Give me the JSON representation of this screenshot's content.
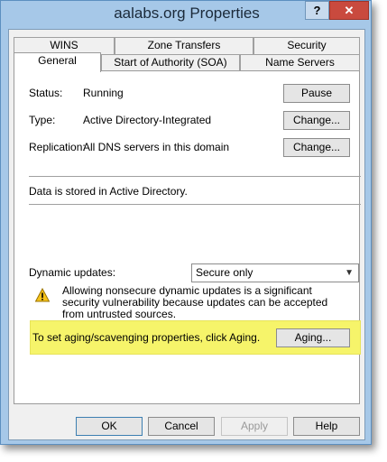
{
  "window": {
    "title": "aalabs.org Properties",
    "help_glyph": "?",
    "close_glyph": "✕"
  },
  "tabs": {
    "row1": [
      "WINS",
      "Zone Transfers",
      "Security"
    ],
    "row2": [
      "General",
      "Start of Authority (SOA)",
      "Name Servers"
    ],
    "active": "General"
  },
  "general": {
    "status_label": "Status:",
    "status_value": "Running",
    "pause_button": "Pause",
    "type_label": "Type:",
    "type_value": "Active Directory-Integrated",
    "type_change_button": "Change...",
    "replication_label": "Replication:",
    "replication_value": "All DNS servers in this domain",
    "replication_change_button": "Change...",
    "storage_text": "Data is stored in Active Directory.",
    "dynamic_updates_label": "Dynamic updates:",
    "dynamic_updates_value": "Secure only",
    "warning_text": "Allowing nonsecure dynamic updates is a significant security vulnerability because updates can be accepted from untrusted sources.",
    "aging_text": "To set aging/scavenging properties, click Aging.",
    "aging_button": "Aging..."
  },
  "footer": {
    "ok": "OK",
    "cancel": "Cancel",
    "apply": "Apply",
    "help": "Help"
  },
  "colors": {
    "highlight": "#f6f46a",
    "frame": "#a6c8e8",
    "close": "#c94a3e"
  }
}
